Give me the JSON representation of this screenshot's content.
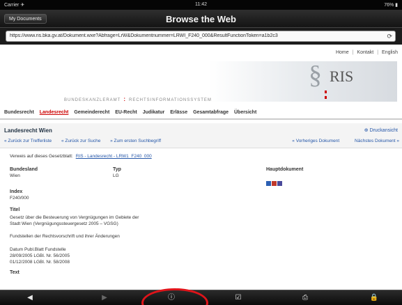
{
  "status": {
    "carrier": "Carrier ✈",
    "clock": "11:42",
    "battery": "76% ▮"
  },
  "nav": {
    "back_label": "My Documents",
    "title": "Browse the Web"
  },
  "address": {
    "url": "https://www.ris.bka.gv.at/Dokument.wxe?Abfrage=LrW&Dokumentnummer=LRWI_F240_000&ResultFunctionToken=a1b2c3",
    "reload_icon": "⟳"
  },
  "page": {
    "top_links": [
      "Home",
      "Kontakt",
      "English"
    ],
    "brand": {
      "left": "BUNDESKANZLERAMT",
      "right": "RECHTSINFORMATIONSSYSTEM",
      "logo": "RIS",
      "para": "§"
    },
    "main_nav": [
      "Bundesrecht",
      "Landesrecht",
      "Gemeinderecht",
      "EU-Recht",
      "Judikatur",
      "Erlässe",
      "Gesamtabfrage",
      "Übersicht"
    ],
    "main_nav_active": "Landesrecht",
    "section_title": "Landesrecht Wien",
    "print_link": "⊕ Druckansicht",
    "crumb_links": [
      "« Zurück zur Trefferliste",
      "« Zurück zur Suche",
      "» Zum ersten Suchbegriff"
    ],
    "pager_links": [
      "« Vorheriges Dokument",
      "Nächstes Dokument »"
    ],
    "verweis_label": "Verweis auf dieses Gesetzblatt:",
    "verweis_link": "RIS - Landesrecht - LRW1_F240_000",
    "fields": {
      "bundesland_label": "Bundesland",
      "bundesland_value": "Wien",
      "typ_label": "Typ",
      "typ_value": "LG",
      "haupt_label": "Hauptdokument",
      "index_label": "Index",
      "index_value": "F240/000",
      "titel_label": "Titel",
      "titel_line1": "Gesetz über die Besteuerung von Vergnügungen im Gebiete der",
      "titel_line2": "Stadt Wien (Vergnügungssteuergesetz 2005 – VGSG)",
      "fundstellen": "Fundstellen der Rechtsvorschrift und ihrer Änderungen",
      "fund_header": "Datum Publ.Blatt Fundstelle",
      "fund_row1": "28/09/2005 LGBl. Nr. 56/2005",
      "fund_row2": "01/12/2008 LGBl. Nr. 58/2008",
      "text_label": "Text"
    }
  },
  "toolbar": {
    "back": "◀",
    "forward": "▶",
    "info": "ⓘ",
    "check": "☑",
    "save": "⎙",
    "lock": "🔒"
  },
  "colors": {
    "active": "#cc0000",
    "link": "#2456a8",
    "highlight": "#e0141a"
  }
}
